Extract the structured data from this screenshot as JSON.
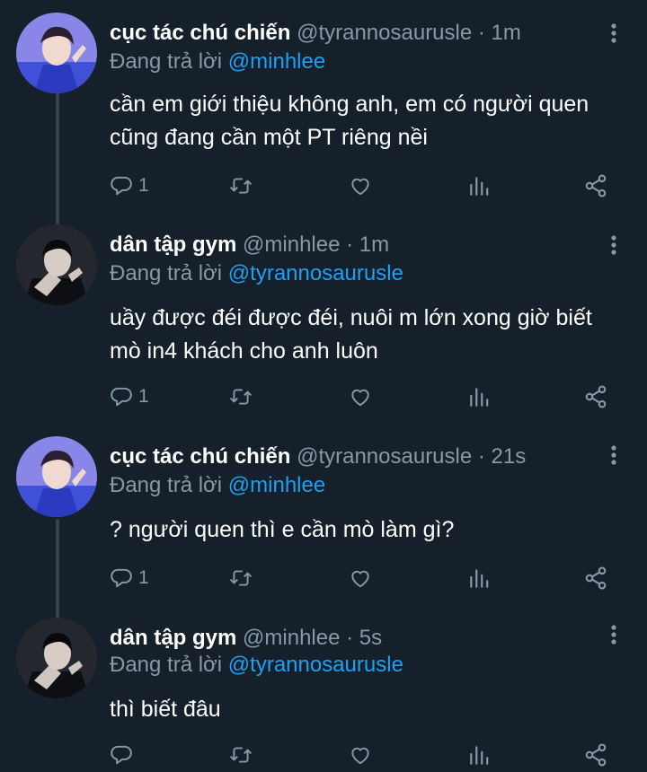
{
  "tweets": [
    {
      "display_name": "cục tác chú chiến",
      "handle": "@tyrannosaurusle",
      "time": "· 1m",
      "reply_prefix": "Đang trả lời ",
      "reply_to": "@minhlee",
      "text": "cần em giới thiệu không anh, em có người quen\ncũng đang cần một PT riêng nềi",
      "reply_count": "1",
      "avatar": "avatar-blue"
    },
    {
      "display_name": "dân tập gym",
      "handle": "@minhlee",
      "time": "· 1m",
      "reply_prefix": "Đang trả lời ",
      "reply_to": "@tyrannosaurusle",
      "text": "uầy được đéi được đéi, nuôi m lớn xong giờ biết\nmò in4 khách cho anh luôn",
      "reply_count": "1",
      "avatar": "avatar-dark"
    },
    {
      "display_name": "cục tác chú chiến",
      "handle": "@tyrannosaurusle",
      "time": "· 21s",
      "reply_prefix": "Đang trả lời ",
      "reply_to": "@minhlee",
      "text": "? người quen thì e cần mò làm gì?",
      "reply_count": "1",
      "avatar": "avatar-blue"
    },
    {
      "display_name": "dân tập gym",
      "handle": "@minhlee",
      "time": "· 5s",
      "reply_prefix": "Đang trả lời ",
      "reply_to": "@tyrannosaurusle",
      "text": "thì biết đâu",
      "reply_count": "",
      "avatar": "avatar-dark"
    }
  ],
  "icons": {
    "reply": "reply-icon",
    "retweet": "retweet-icon",
    "like": "like-icon",
    "analytics": "analytics-icon",
    "share": "share-icon",
    "more": "more-options-icon"
  },
  "colors": {
    "background": "#15202b",
    "secondary_text": "#8899a6",
    "link": "#1da1f2",
    "thread_line": "#38444d"
  }
}
